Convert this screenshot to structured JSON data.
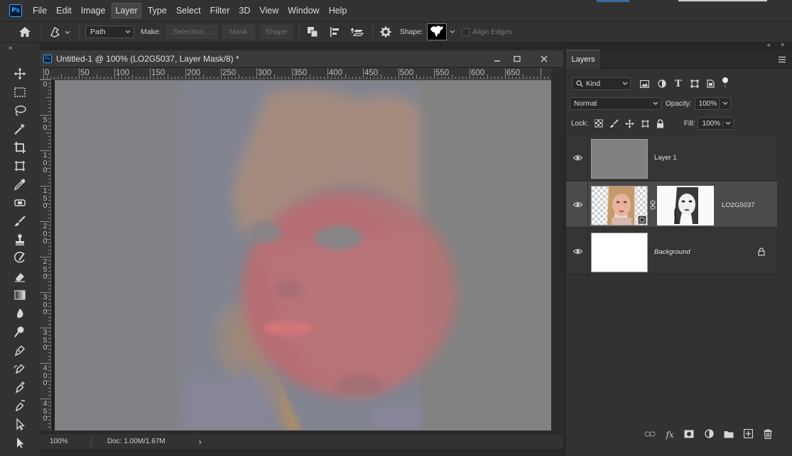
{
  "app": {
    "logo": "Ps"
  },
  "menu": [
    "File",
    "Edit",
    "Image",
    "Layer",
    "Type",
    "Select",
    "Filter",
    "3D",
    "View",
    "Window",
    "Help"
  ],
  "menu_active": "Layer",
  "options": {
    "mode_value": "Path",
    "make_label": "Make:",
    "selection_label": "Selection...",
    "mask_label": "Mask",
    "shape_btn_label": "Shape",
    "shape_label": "Shape:",
    "align_edges_label": "Align Edges"
  },
  "toolbar_icons": [
    "move-icon",
    "marquee-icon",
    "lasso-icon",
    "magic-wand-icon",
    "crop-icon",
    "frame-icon",
    "eyedropper-icon",
    "spot-healing-icon",
    "brush-icon",
    "clone-stamp-icon",
    "history-brush-icon",
    "eraser-icon",
    "gradient-icon",
    "blur-icon",
    "dodge-icon",
    "pen-icon",
    "freeform-pen-icon",
    "add-anchor-icon",
    "convert-point-icon",
    "path-selection-icon",
    "direct-selection-icon"
  ],
  "document": {
    "title": "Untitled-1 @ 100% (LO2G5037, Layer Mask/8) *",
    "ruler_h": [
      "0",
      "50",
      "100",
      "150",
      "200",
      "250",
      "300",
      "350",
      "400",
      "450",
      "500",
      "550",
      "600",
      "650"
    ],
    "ruler_v": [
      "0",
      "5\n0",
      "1\n0\n0",
      "1\n5\n0",
      "2\n0\n0",
      "2\n5\n0",
      "3\n0\n0",
      "3\n5\n0",
      "4\n0\n0",
      "4\n5\n0"
    ],
    "zoom": "100%",
    "doc_size": "Doc: 1.00M/1.67M",
    "status_arrow": "›"
  },
  "layers_panel": {
    "tab": "Layers",
    "kind_label": "Kind",
    "blend_mode": "Normal",
    "opacity_label": "Opacity:",
    "opacity_value": "100%",
    "lock_label": "Lock:",
    "fill_label": "Fill:",
    "fill_value": "100%",
    "layers": [
      {
        "name": "Layer 1",
        "selected": false
      },
      {
        "name": "LO2G5037",
        "selected": true
      },
      {
        "name": "Background",
        "selected": false
      }
    ]
  },
  "colors": {
    "bg_dark": "#282828",
    "panel": "#323232",
    "accent": "#31a8ff",
    "canvas_gray": "#818285"
  }
}
